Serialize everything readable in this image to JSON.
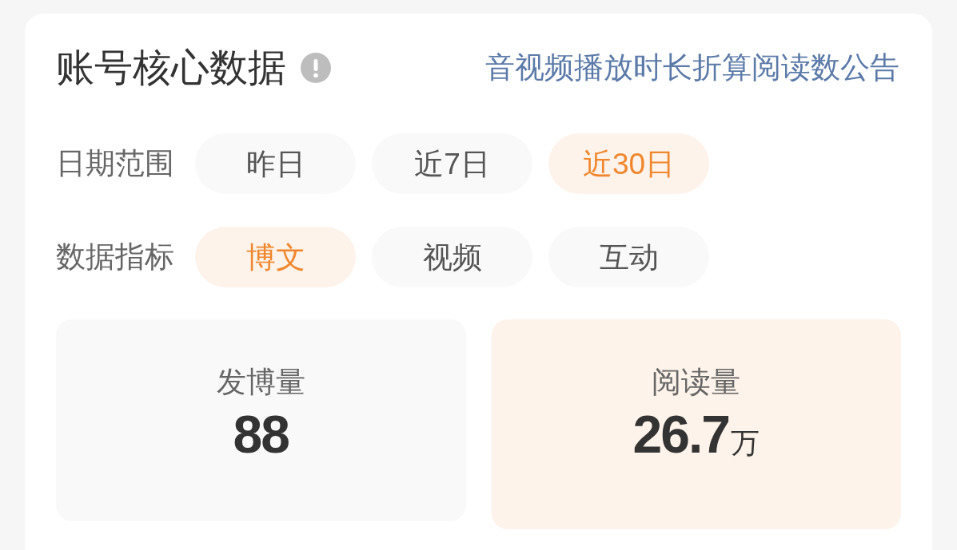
{
  "header": {
    "title": "账号核心数据",
    "notice_link": "音视频播放时长折算阅读数公告"
  },
  "filters": [
    {
      "label": "日期范围",
      "options": [
        {
          "label": "昨日",
          "selected": false
        },
        {
          "label": "近7日",
          "selected": false
        },
        {
          "label": "近30日",
          "selected": true
        }
      ]
    },
    {
      "label": "数据指标",
      "options": [
        {
          "label": "博文",
          "selected": true
        },
        {
          "label": "视频",
          "selected": false
        },
        {
          "label": "互动",
          "selected": false
        }
      ]
    }
  ],
  "stats": [
    {
      "label": "发博量",
      "value": "88",
      "selected": false
    },
    {
      "label": "阅读量",
      "value": "26.7",
      "unit": "万",
      "selected": true
    }
  ]
}
